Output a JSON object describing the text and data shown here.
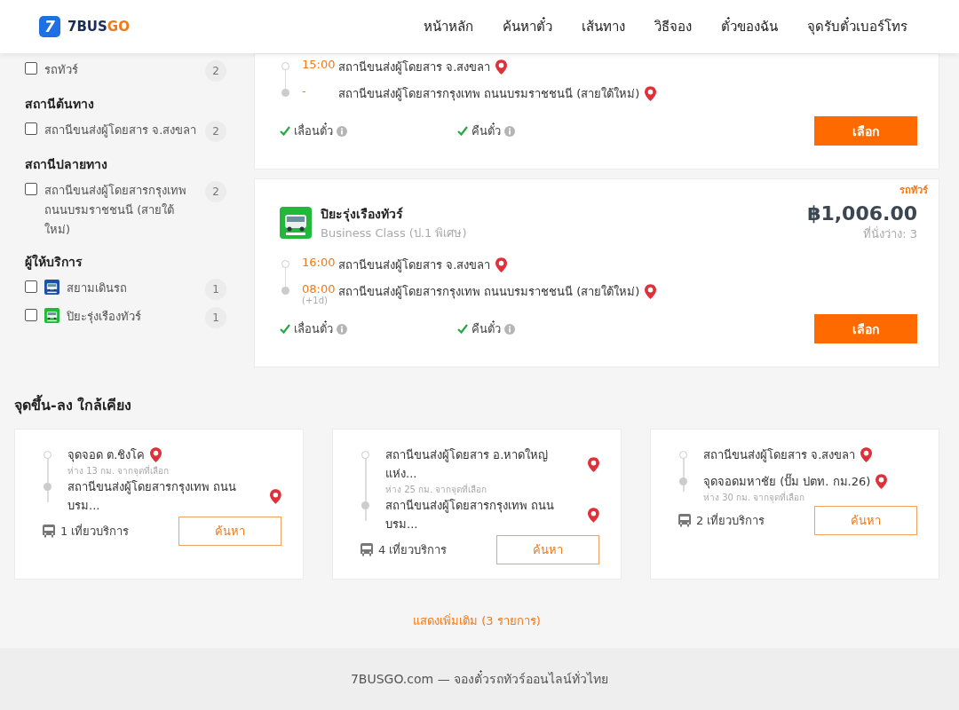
{
  "header": {
    "logo_mark": "7",
    "logo_main": "7BUS",
    "logo_accent": "GO",
    "nav": [
      {
        "label": "หน้าหลัก"
      },
      {
        "label": "ค้นหาตั๋ว"
      },
      {
        "label": "เส้นทาง"
      },
      {
        "label": "วิธีจอง"
      },
      {
        "label": "ตั๋วของฉัน"
      },
      {
        "label": "จุดรับตั๋วเบอร์โทร"
      }
    ]
  },
  "sidebar": {
    "sections": [
      {
        "items": [
          {
            "label": "รถทัวร์",
            "count": "2",
            "checked": false
          }
        ]
      },
      {
        "title": "สถานีต้นทาง",
        "items": [
          {
            "label": "สถานีขนส่งผู้โดยสาร จ.สงขลา",
            "count": "2",
            "checked": false
          }
        ]
      },
      {
        "title": "สถานีปลายทาง",
        "items": [
          {
            "label": "สถานีขนส่งผู้โดยสารกรุงเทพ ถนนบรมราชชนนี (สายใต้ใหม่)",
            "count": "2",
            "checked": false
          }
        ]
      },
      {
        "title": "ผู้ให้บริการ",
        "items": [
          {
            "label": "สยามเดินรถ",
            "count": "1",
            "checked": false,
            "color": "#1f4fa8"
          },
          {
            "label": "ปิยะรุ่งเรืองทัวร์",
            "count": "1",
            "checked": false,
            "color": "#22b83a"
          }
        ]
      }
    ]
  },
  "results": [
    {
      "stops": [
        {
          "time": "15:00",
          "name": "สถานีขนส่งผู้โดยสาร จ.สงขลา"
        },
        {
          "time": "-",
          "name": "สถานีขนส่งผู้โดยสารกรุงเทพ ถนนบรมราชชนนี (สายใต้ใหม่)"
        }
      ],
      "features": [
        {
          "label": "เลื่อนตั๋ว",
          "available": true
        },
        {
          "label": "คืนตั๋ว",
          "available": true
        }
      ],
      "button": "เลือก"
    },
    {
      "tag": "รถทัวร์",
      "operator": "ปิยะรุ่งเรืองทัวร์",
      "color": "#22b83a",
      "bus_class": "Business Class (ป.1 พิเศษ)",
      "price": "฿1,006.00",
      "seats": "ที่นั่งว่าง: 3",
      "stops": [
        {
          "time": "16:00",
          "name": "สถานีขนส่งผู้โดยสาร จ.สงขลา"
        },
        {
          "time": "08:00",
          "name": "สถานีขนส่งผู้โดยสารกรุงเทพ ถนนบรมราชชนนี (สายใต้ใหม่)",
          "day_offset": "(+1d)"
        }
      ],
      "features": [
        {
          "label": "เลื่อนตั๋ว",
          "available": true
        },
        {
          "label": "คืนตั๋ว",
          "available": true
        }
      ],
      "button": "เลือก"
    }
  ],
  "nearby": {
    "title": "จุดขึ้น-ลง ใกล้เคียง",
    "cards": [
      {
        "stops": [
          {
            "name": "จุดจอด ต.ชิงโค",
            "distance": "ห่าง 13 กม. จากจุดที่เลือก"
          },
          {
            "name": "สถานีขนส่งผู้โดยสารกรุงเทพ ถนนบรม..."
          }
        ],
        "trips": "1 เที่ยวบริการ",
        "button": "ค้นหา"
      },
      {
        "stops": [
          {
            "name": "สถานีขนส่งผู้โดยสาร อ.หาดใหญ่ แห่ง...",
            "distance": "ห่าง 25 กม. จากจุดที่เลือก"
          },
          {
            "name": "สถานีขนส่งผู้โดยสารกรุงเทพ ถนนบรม..."
          }
        ],
        "trips": "4 เที่ยวบริการ",
        "button": "ค้นหา"
      },
      {
        "stops": [
          {
            "name": "สถานีขนส่งผู้โดยสาร จ.สงขลา"
          },
          {
            "name": "จุดจอดมหาชัย (ปั๊ม ปตท. กม.26)",
            "distance": "ห่าง 30 กม. จากจุดที่เลือก"
          }
        ],
        "trips": "2 เที่ยวบริการ",
        "button": "ค้นหา"
      }
    ],
    "more": "แสดงเพิ่มเติม (3 รายการ)"
  },
  "footer": {
    "text": "7BUSGO.com — จองตั๋วรถทัวร์ออนไลน์ทั่วไทย"
  }
}
